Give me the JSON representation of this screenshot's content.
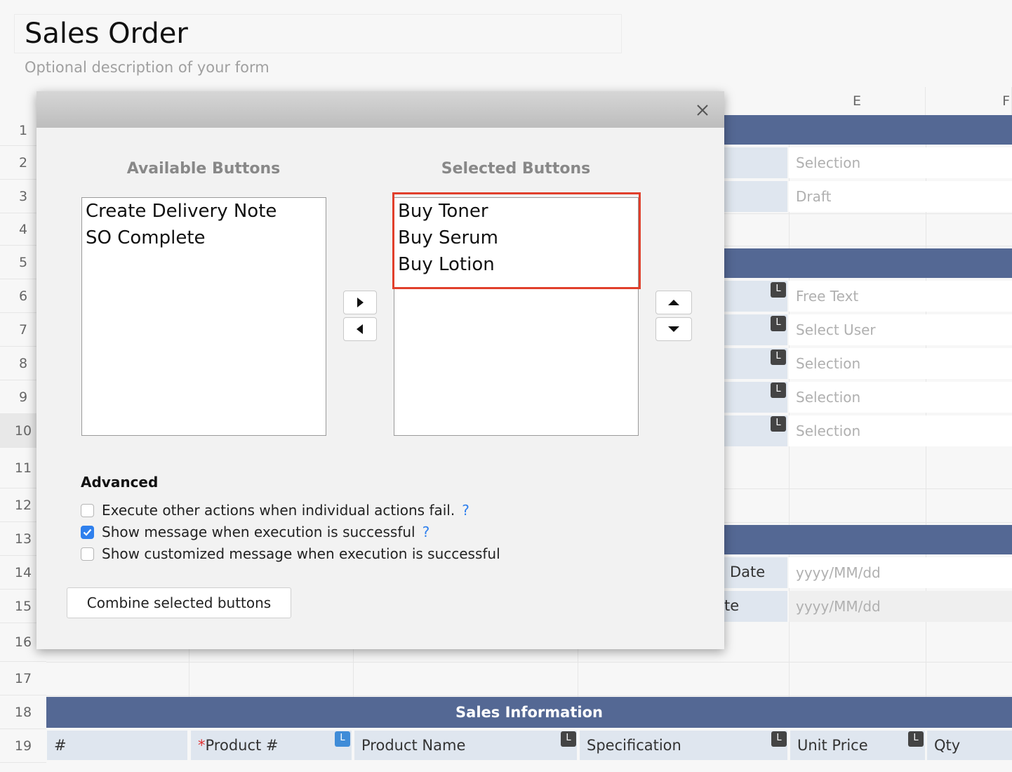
{
  "form": {
    "title": "Sales Order",
    "description": "Optional description of your form"
  },
  "grid": {
    "columns": [
      "E",
      "F"
    ],
    "rows": [
      "1",
      "2",
      "3",
      "4",
      "5",
      "6",
      "7",
      "8",
      "9",
      "10",
      "11",
      "12",
      "13",
      "14",
      "15",
      "16",
      "17",
      "18",
      "19"
    ],
    "values": {
      "r2": "Selection",
      "r3": "Draft",
      "r6": "Free Text",
      "r7": "Select User",
      "r8": "Selection",
      "r9": "Selection",
      "r10": "Selection",
      "r14": "yyyy/MM/dd",
      "r15": "yyyy/MM/dd"
    },
    "badge": "L",
    "partial_labels": {
      "r14": "Date",
      "r15": "te"
    },
    "section_title": "Sales Information",
    "table_headers": {
      "num": "#",
      "required_mark": "*",
      "product_no": "Product #",
      "product_name": "Product Name",
      "specification": "Specification",
      "unit_price": "Unit Price",
      "qty": "Qty"
    }
  },
  "dialog": {
    "available_title": "Available Buttons",
    "selected_title": "Selected Buttons",
    "available": [
      "Create Delivery Note",
      "SO Complete"
    ],
    "selected": [
      "Buy Toner",
      "Buy Serum",
      "Buy Lotion"
    ],
    "advanced_title": "Advanced",
    "options": [
      {
        "label": "Execute other actions when individual actions fail.",
        "checked": false,
        "help": "?"
      },
      {
        "label": "Show message when execution is successful",
        "checked": true,
        "help": "?"
      },
      {
        "label": "Show customized message when execution is successful",
        "checked": false,
        "help": ""
      }
    ],
    "combine_label": "Combine selected buttons"
  },
  "colors": {
    "band": "#546894",
    "label_cell": "#dfe6ef",
    "highlight": "#e1402c",
    "checkbox_on": "#2f80ed"
  }
}
